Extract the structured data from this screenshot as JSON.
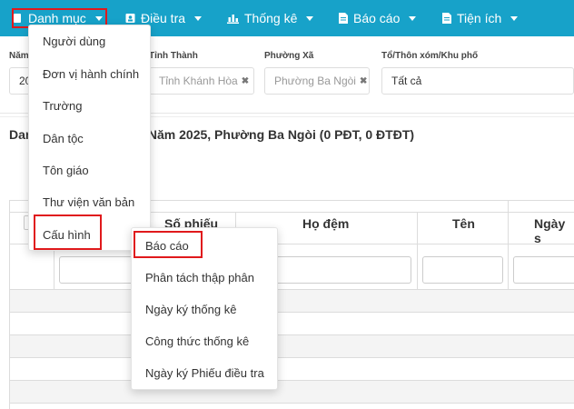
{
  "nav": {
    "items": [
      {
        "label": "Danh mục",
        "icon": "book-icon"
      },
      {
        "label": "Điều tra",
        "icon": "id-card-icon"
      },
      {
        "label": "Thống kê",
        "icon": "bar-chart-icon"
      },
      {
        "label": "Báo cáo",
        "icon": "file-icon"
      },
      {
        "label": "Tiện ích",
        "icon": "file-icon"
      }
    ],
    "bg_color": "#17a2c9",
    "highlight_color": "#e0191c"
  },
  "filters": {
    "year_label": "Năm",
    "year_value": "20",
    "province_label": "Tỉnh Thành",
    "province_value": "Tỉnh Khánh Hòa",
    "ward_label": "Phường Xã",
    "ward_value": "Phường Ba Ngòi",
    "hamlet_label": "Tổ/Thôn xóm/Khu phố",
    "hamlet_value": "Tất cả"
  },
  "report": {
    "title_prefix": "Dan",
    "title_suffix": "n Năm 2025, Phường Ba Ngòi (0 PĐT, 0 ĐTĐT)"
  },
  "table": {
    "headers": [
      "Số phiếu",
      "Họ đệm",
      "Tên",
      "Ngày s"
    ]
  },
  "danh_muc_menu": {
    "items": [
      "Người dùng",
      "Đơn vị hành chính",
      "Trường",
      "Dân tộc",
      "Tôn giáo",
      "Thư viện văn bản",
      "Cấu hình"
    ]
  },
  "cau_hinh_submenu": {
    "items": [
      "Báo cáo",
      "Phân tách thập phân",
      "Ngày ký thống kê",
      "Công thức thống kê",
      "Ngày ký Phiếu điều tra"
    ]
  }
}
